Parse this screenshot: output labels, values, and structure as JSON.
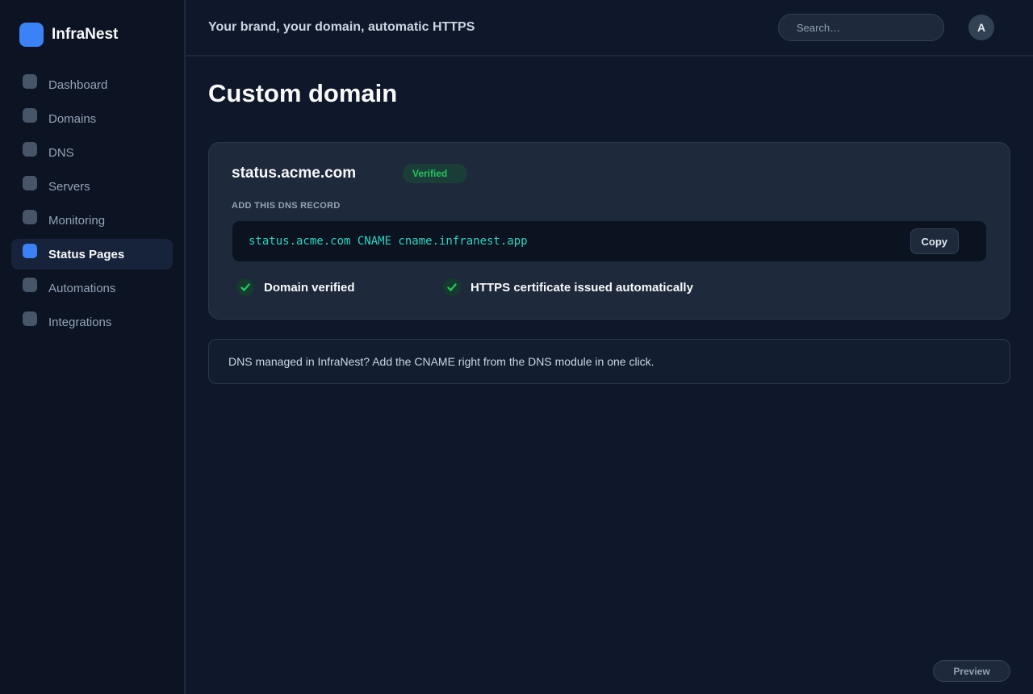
{
  "brand": {
    "name": "InfraNest",
    "accent": "#3b82f6"
  },
  "sidebar": {
    "items": [
      {
        "label": "Dashboard",
        "icon": "dashboard-icon",
        "active": false
      },
      {
        "label": "Domains",
        "icon": "domains-icon",
        "active": false
      },
      {
        "label": "DNS",
        "icon": "dns-icon",
        "active": false
      },
      {
        "label": "Servers",
        "icon": "servers-icon",
        "active": false
      },
      {
        "label": "Monitoring",
        "icon": "monitoring-icon",
        "active": false
      },
      {
        "label": "Status Pages",
        "icon": "status-pages-icon",
        "active": true
      },
      {
        "label": "Automations",
        "icon": "automations-icon",
        "active": false
      },
      {
        "label": "Integrations",
        "icon": "integrations-icon",
        "active": false
      }
    ]
  },
  "header": {
    "tagline": "Your brand, your domain, automatic HTTPS",
    "search_placeholder": "Search…",
    "avatar_initial": "A"
  },
  "page": {
    "title": "Custom domain"
  },
  "domain_card": {
    "domain": "status.acme.com",
    "badge": "Verified",
    "section_label": "ADD THIS DNS RECORD",
    "record": "status.acme.com CNAME cname.infranest.app",
    "copy_label": "Copy",
    "checks": [
      {
        "label": "Domain verified",
        "icon": "check-icon"
      },
      {
        "label": "HTTPS certificate issued automatically",
        "icon": "check-icon"
      }
    ]
  },
  "info": {
    "text": "DNS managed in InfraNest? Add the CNAME right from the DNS module in one click."
  },
  "footer": {
    "preview_label": "Preview"
  },
  "colors": {
    "success": "#22c55e",
    "record_text": "#2dd4bf",
    "background": "#0f172a"
  }
}
